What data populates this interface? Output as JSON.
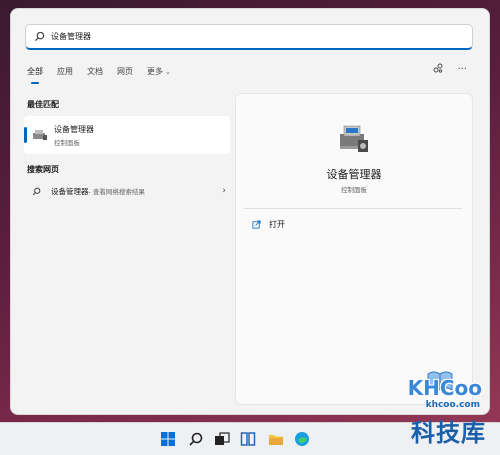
{
  "search": {
    "value": "设备管理器"
  },
  "tabs": [
    {
      "label": "全部"
    },
    {
      "label": "应用"
    },
    {
      "label": "文档"
    },
    {
      "label": "网页"
    },
    {
      "label": "更多"
    }
  ],
  "sections": {
    "best_match": "最佳匹配",
    "web_search": "搜索网页"
  },
  "best_match_item": {
    "name": "设备管理器",
    "subtitle": "控制面板"
  },
  "web_result": {
    "query": "设备管理器",
    "hint": " - 查看网络搜索结果"
  },
  "detail": {
    "title": "设备管理器",
    "subtitle": "控制面板",
    "action_open": "打开"
  },
  "watermark": {
    "brand": "KHCoo",
    "site": "khcoo.com",
    "name_cn": "科技库"
  },
  "colors": {
    "accent": "#0067c0",
    "panel_bg": "#f3f3f3",
    "wallpaper": "#5a1e3c"
  },
  "icons": {
    "search": "search-icon",
    "device_manager": "device-manager-icon",
    "open": "open-icon",
    "share": "share-icon",
    "more": "more-options-icon"
  }
}
